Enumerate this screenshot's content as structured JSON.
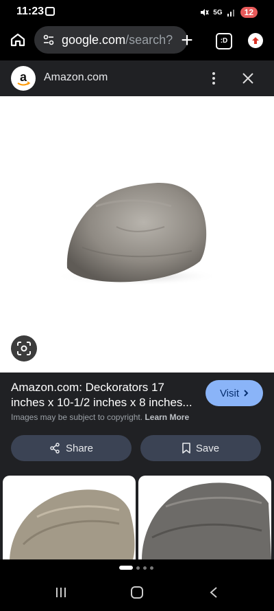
{
  "status": {
    "time": "11:23",
    "network": "5G",
    "battery": "12"
  },
  "browser": {
    "url_host": "google.com",
    "url_path": "/search?",
    "tabs_count_glyph": ":D"
  },
  "source": {
    "name": "Amazon.com",
    "logo_letter": "a"
  },
  "result": {
    "title_line1": "Amazon.com: Deckorators 17",
    "title_line2": "inches x 10-1/2 inches x 8 inches...",
    "copyright_text": "Images may be subject to copyright.",
    "learn_more": "Learn More",
    "visit_label": "Visit",
    "share_label": "Share",
    "save_label": "Save"
  },
  "icons": {
    "home": "home-icon",
    "url": "tune-icon",
    "new_tab": "plus-icon",
    "tabs": "tab-switcher-icon",
    "account": "upload-icon",
    "more": "more-vert-icon",
    "close": "close-icon",
    "lens": "lens-icon",
    "visit": "chevron-right-icon",
    "share": "share-icon",
    "save": "bookmark-icon"
  },
  "colors": {
    "accent": "#8ab4f8",
    "button_bg": "#3b4354",
    "panel_bg": "#202124"
  }
}
